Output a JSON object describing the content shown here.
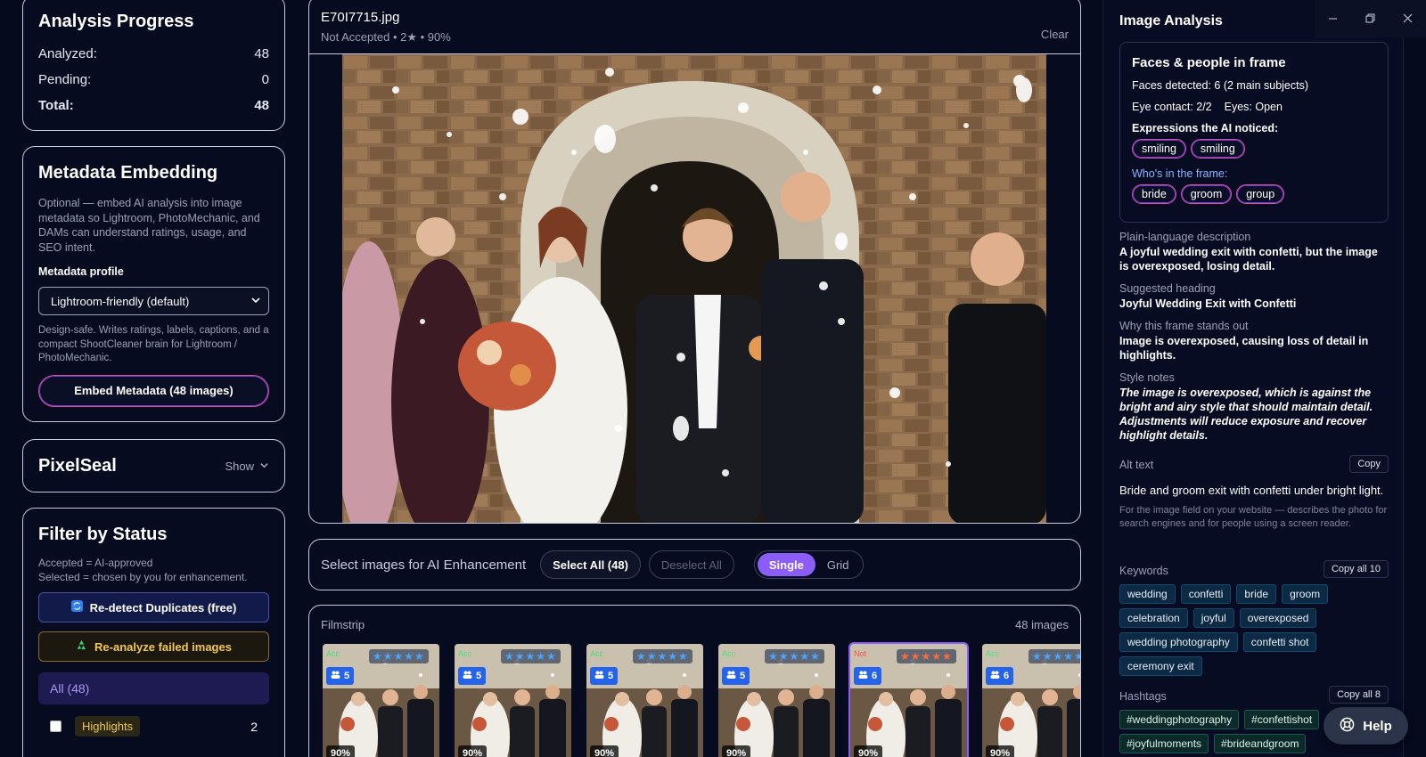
{
  "progress": {
    "title": "Analysis Progress",
    "analyzed_label": "Analyzed:",
    "analyzed": "48",
    "pending_label": "Pending:",
    "pending": "0",
    "total_label": "Total:",
    "total": "48"
  },
  "metadata": {
    "title": "Metadata Embedding",
    "description": "Optional — embed AI analysis into image metadata so Lightroom, PhotoMechanic, and DAMs can understand ratings, usage, and SEO intent.",
    "profile_label": "Metadata profile",
    "profile_value": "Lightroom-friendly (default)",
    "profile_note": "Design-safe. Writes ratings, labels, captions, and a compact ShootCleaner brain for Lightroom / PhotoMechanic.",
    "embed_button": "Embed Metadata (48 images)"
  },
  "pixelseal": {
    "title": "PixelSeal",
    "show_label": "Show"
  },
  "filter": {
    "title": "Filter by Status",
    "line1": "Accepted = AI-approved",
    "line2": "Selected = chosen by you for enhancement.",
    "redetect_button": "Re-detect Duplicates (free)",
    "reanalyze_button": "Re-analyze failed images",
    "all_label": "All (48)",
    "highlights_label": "Highlights",
    "highlights_count": "2"
  },
  "viewer": {
    "filename": "E70I7715.jpg",
    "meta": "Not Accepted • 2★ • 90%",
    "clear_label": "Clear"
  },
  "selection": {
    "label": "Select images for AI Enhancement",
    "select_all": "Select All (48)",
    "deselect_all": "Deselect All",
    "single": "Single",
    "grid": "Grid"
  },
  "filmstrip": {
    "title": "Filmstrip",
    "count": "48 images",
    "thumbs": [
      {
        "tag": "Acc",
        "stars": "★★★★★",
        "faces": "5",
        "pct": "90%",
        "selected": false,
        "variant": "blue"
      },
      {
        "tag": "Acc",
        "stars": "★★★★★",
        "faces": "5",
        "pct": "90%",
        "selected": false,
        "variant": "blue"
      },
      {
        "tag": "Acc",
        "stars": "★★★★★",
        "faces": "5",
        "pct": "90%",
        "selected": false,
        "variant": "blue"
      },
      {
        "tag": "Acc",
        "stars": "★★★★★",
        "faces": "5",
        "pct": "90%",
        "selected": false,
        "variant": "blue"
      },
      {
        "tag": "Not",
        "stars": "★★★★★",
        "faces": "6",
        "pct": "90%",
        "selected": true,
        "variant": "red"
      },
      {
        "tag": "Acc",
        "stars": "★★★★★",
        "faces": "6",
        "pct": "90%",
        "selected": false,
        "variant": "blue"
      }
    ]
  },
  "analysis": {
    "title": "Image Analysis",
    "faces_title": "Faces & people in frame",
    "faces_detected": "Faces detected: 6  (2 main subjects)",
    "eye_contact": "Eye contact: 2/2",
    "eyes": "Eyes: Open",
    "expressions_label": "Expressions the AI noticed:",
    "expressions": [
      "smiling",
      "smiling"
    ],
    "who_label": "Who's in the frame:",
    "who": [
      "bride",
      "groom",
      "group"
    ],
    "plain_label": "Plain-language description",
    "plain_value": "A joyful wedding exit with confetti, but the image is overexposed, losing detail.",
    "heading_label": "Suggested heading",
    "heading_value": "Joyful Wedding Exit with Confetti",
    "why_label": "Why this frame stands out",
    "why_value": "Image is overexposed, causing loss of detail in highlights.",
    "style_label": "Style notes",
    "style_value": "The image is overexposed, which is against the bright and airy style that should maintain detail. Adjustments will reduce exposure and recover highlight details.",
    "alt_label": "Alt text",
    "alt_copy": "Copy",
    "alt_value": "Bride and groom exit with confetti under bright light.",
    "alt_note": "For the image field on your website — describes the photo for search engines and for people using a screen reader.",
    "keywords_label": "Keywords",
    "keywords_copy": "Copy all 10",
    "keywords": [
      "wedding",
      "confetti",
      "bride",
      "groom",
      "celebration",
      "joyful",
      "overexposed",
      "wedding photography",
      "confetti shot",
      "ceremony exit"
    ],
    "hashtags_label": "Hashtags",
    "hashtags_copy": "Copy all 8",
    "hashtags": [
      "#weddingphotography",
      "#confettishot",
      "#joyfulmoments",
      "#brideandgroom"
    ]
  },
  "help_label": "Help",
  "colors": {
    "accent": "#8b5cf6",
    "background": "#050a1c",
    "card_border": "#c7cbe0"
  }
}
